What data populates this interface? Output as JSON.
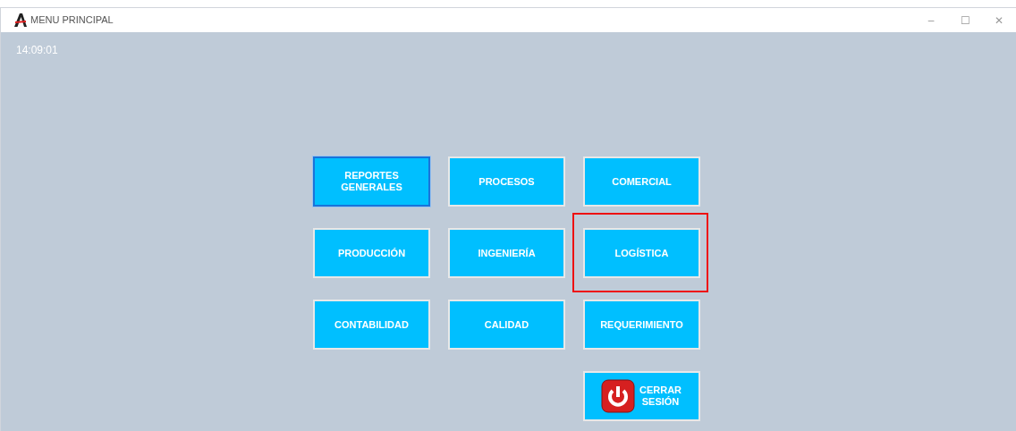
{
  "window": {
    "title": "MENU PRINCIPAL",
    "controls": [
      "–",
      "☐",
      "✕"
    ]
  },
  "clock": "14:09:01",
  "buttons": [
    {
      "label": "REPORTES GENERALES",
      "kind": "text",
      "focused": true,
      "highlighted": false
    },
    {
      "label": "PROCESOS",
      "kind": "text",
      "focused": false,
      "highlighted": false
    },
    {
      "label": "COMERCIAL",
      "kind": "text",
      "focused": false,
      "highlighted": false
    },
    {
      "label": "PRODUCCIÓN",
      "kind": "text",
      "focused": false,
      "highlighted": false
    },
    {
      "label": "INGENIERÍA",
      "kind": "text",
      "focused": false,
      "highlighted": false
    },
    {
      "label": "LOGÍSTICA",
      "kind": "text",
      "focused": false,
      "highlighted": true
    },
    {
      "label": "CONTABILIDAD",
      "kind": "text",
      "focused": false,
      "highlighted": false
    },
    {
      "label": "CALIDAD",
      "kind": "text",
      "focused": false,
      "highlighted": false
    },
    {
      "label": "REQUERIMIENTO",
      "kind": "text",
      "focused": false,
      "highlighted": false
    },
    {
      "label": "CERRAR SESIÓN",
      "kind": "logout",
      "focused": false,
      "highlighted": false
    }
  ]
}
